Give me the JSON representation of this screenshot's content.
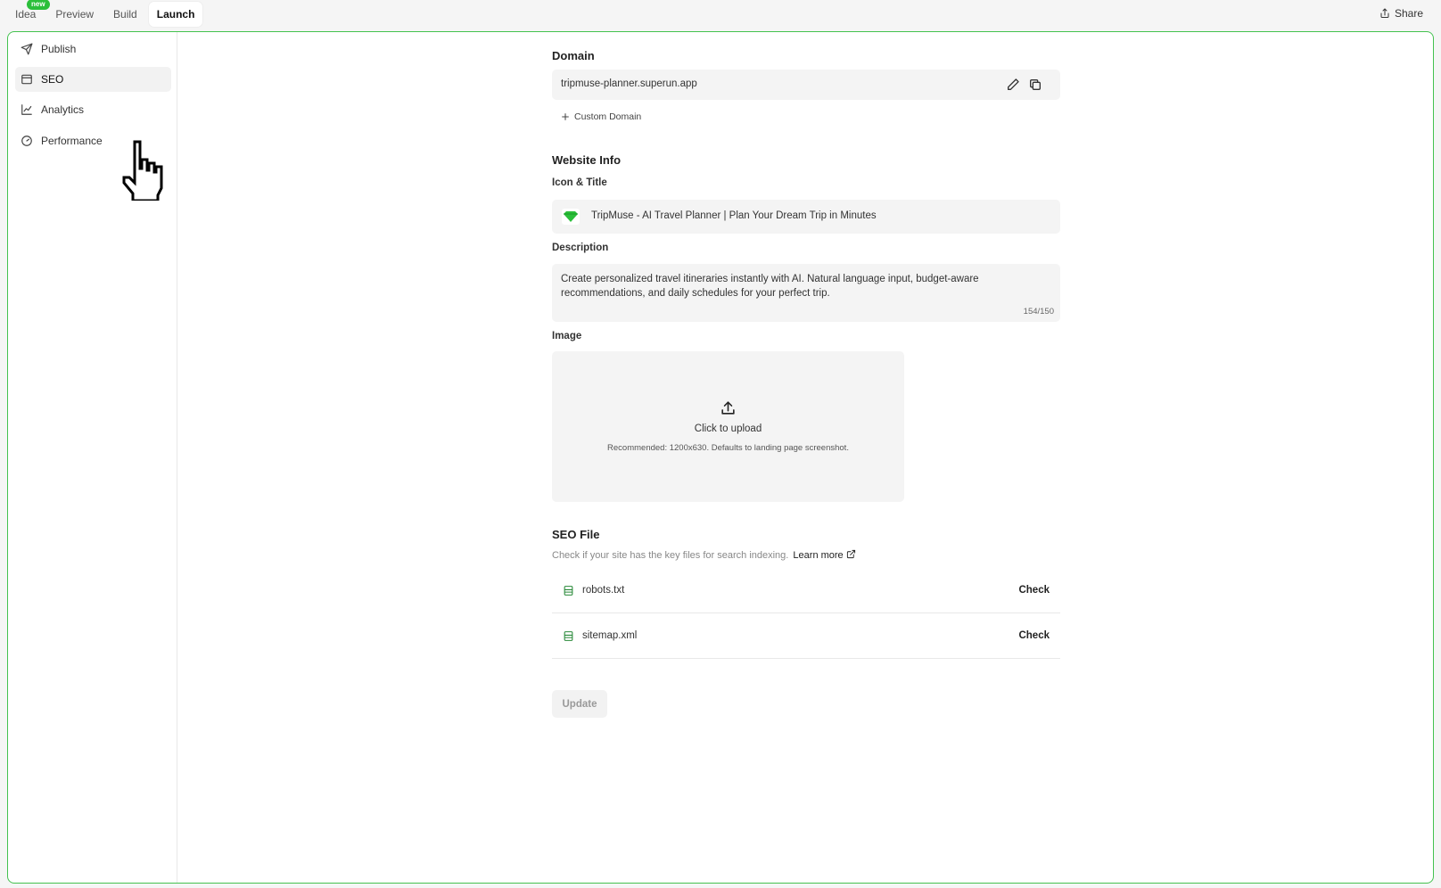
{
  "tabs": [
    {
      "label": "Idea",
      "badge": "new"
    },
    {
      "label": "Preview"
    },
    {
      "label": "Build"
    },
    {
      "label": "Launch",
      "active": true
    }
  ],
  "share_label": "Share",
  "sidebar": {
    "items": [
      {
        "label": "Publish",
        "icon": "send-icon"
      },
      {
        "label": "SEO",
        "icon": "window-icon",
        "active": true
      },
      {
        "label": "Analytics",
        "icon": "chart-line-icon"
      },
      {
        "label": "Performance",
        "icon": "gauge-icon"
      }
    ]
  },
  "domain": {
    "heading": "Domain",
    "value": "tripmuse-planner.superun.app",
    "custom_domain_label": "Custom Domain"
  },
  "website_info": {
    "heading": "Website Info",
    "icon_title_label": "Icon & Title",
    "title_value": "TripMuse - AI Travel Planner | Plan Your Dream Trip in Minutes",
    "description_label": "Description",
    "description_value": "Create personalized travel itineraries instantly with AI. Natural language input, budget-aware recommendations, and daily schedules for your perfect trip.",
    "char_count": "154/150",
    "image_label": "Image",
    "upload_label": "Click to upload",
    "upload_hint": "Recommended: 1200x630. Defaults to landing page screenshot."
  },
  "seo_file": {
    "heading": "SEO File",
    "description": "Check if your site has the key files for search indexing.",
    "learn_more": "Learn more",
    "files": [
      {
        "name": "robots.txt",
        "action": "Check"
      },
      {
        "name": "sitemap.xml",
        "action": "Check"
      }
    ]
  },
  "update_label": "Update",
  "colors": {
    "accent_green": "#2bbf3a",
    "frame_border": "#44c24f"
  }
}
